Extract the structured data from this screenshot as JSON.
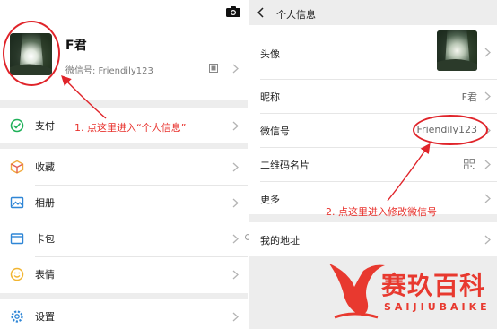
{
  "left": {
    "profile": {
      "nickname": "F君",
      "wechat_id": "微信号: Friendily123",
      "camera_icon": "camera-icon",
      "qr_icon": "qr-code-icon"
    },
    "menu": [
      {
        "label": "支付",
        "icon": "pay-icon",
        "color": "#20b15a"
      },
      {
        "label": "收藏",
        "icon": "favorites-cube-icon",
        "color": "#f1a93b"
      },
      {
        "label": "相册",
        "icon": "album-icon",
        "color": "#2f86d6"
      },
      {
        "label": "卡包",
        "icon": "card-wallet-icon",
        "color": "#2f86d6"
      },
      {
        "label": "表情",
        "icon": "sticker-smiley-icon",
        "color": "#f2b531"
      },
      {
        "label": "设置",
        "icon": "settings-gear-icon",
        "color": "#2f86d6"
      }
    ],
    "annotation": "1. 点这里进入“个人信息”"
  },
  "right": {
    "header_title": "个人信息",
    "rows": [
      {
        "label": "头像",
        "value": ""
      },
      {
        "label": "昵称",
        "value": "F君"
      },
      {
        "label": "微信号",
        "value": "Friendily123"
      },
      {
        "label": "二维码名片",
        "value": ""
      },
      {
        "label": "更多",
        "value": ""
      },
      {
        "label": "我的地址",
        "value": ""
      }
    ],
    "annotation": "2. 点这里进入修改微信号"
  },
  "watermark": {
    "text": "赛玖百科",
    "sub": "SAIJIUBAIKE"
  },
  "colors": {
    "annotation_red": "#e8322d",
    "background_gray": "#ededed",
    "watermark_red": "#e8392f"
  }
}
